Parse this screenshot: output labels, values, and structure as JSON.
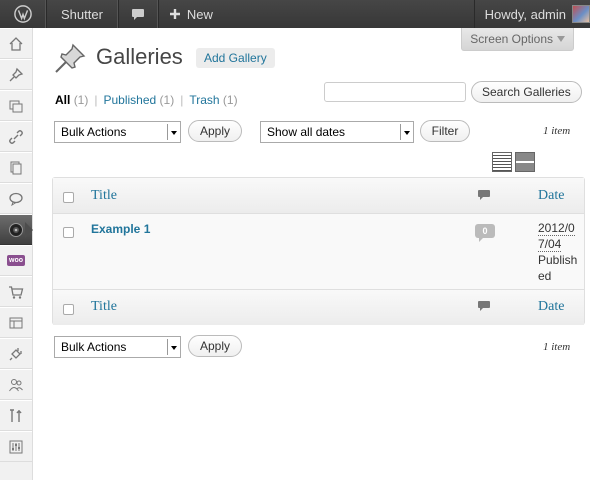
{
  "adminbar": {
    "site_name": "Shutter",
    "new_label": "New",
    "howdy": "Howdy, admin"
  },
  "menu": {
    "items": [
      {
        "icon": "dashboard-icon"
      },
      {
        "icon": "pin-icon"
      },
      {
        "icon": "media-icon"
      },
      {
        "icon": "links-icon"
      },
      {
        "icon": "pages-icon"
      },
      {
        "icon": "comments-icon"
      },
      {
        "icon": "galleries-icon",
        "current": true
      },
      {
        "icon": "woocommerce-icon",
        "badge": "woo"
      },
      {
        "icon": "products-icon"
      },
      {
        "icon": "appearance-icon"
      },
      {
        "icon": "plugins-icon"
      },
      {
        "icon": "users-icon"
      },
      {
        "icon": "tools-icon"
      },
      {
        "icon": "settings-icon"
      }
    ]
  },
  "screen_options": "Screen Options",
  "page": {
    "title": "Galleries",
    "add_new": "Add Gallery"
  },
  "filters": {
    "all_label": "All",
    "all_count": "(1)",
    "published_label": "Published",
    "published_count": "(1)",
    "trash_label": "Trash",
    "trash_count": "(1)",
    "separator": "|"
  },
  "search": {
    "placeholder": "",
    "button": "Search Galleries"
  },
  "tablenav_top": {
    "bulk_actions": "Bulk Actions",
    "apply": "Apply",
    "dates": "Show all dates",
    "filter": "Filter",
    "count": "1 item"
  },
  "table": {
    "columns": {
      "title": "Title",
      "date": "Date"
    },
    "rows": [
      {
        "title": "Example 1",
        "comments": "0",
        "date": "2012/07/04",
        "status": "Published"
      }
    ]
  },
  "tablenav_bottom": {
    "bulk_actions": "Bulk Actions",
    "apply": "Apply",
    "count": "1 item"
  },
  "colors": {
    "link": "#21759b",
    "adminbar": "#464646"
  }
}
